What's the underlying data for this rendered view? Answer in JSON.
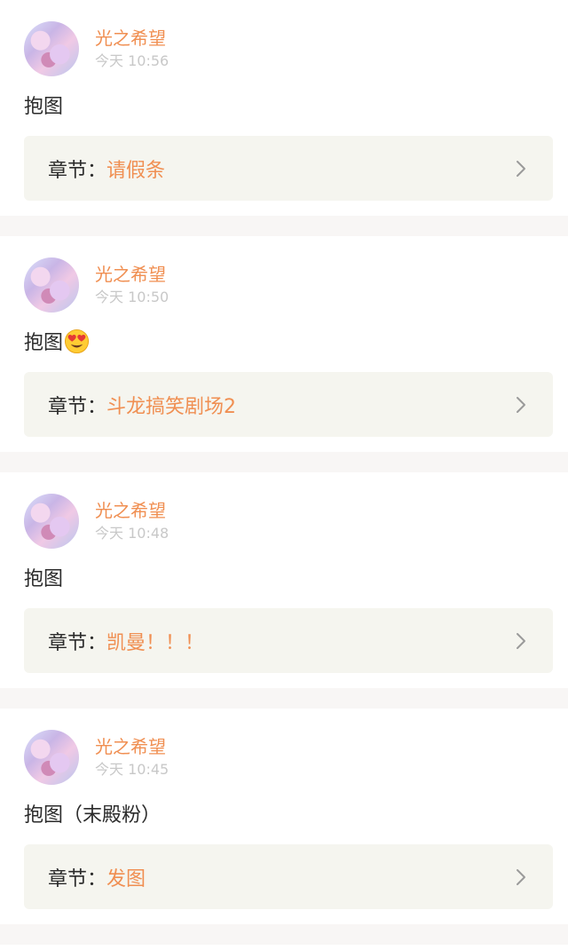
{
  "posts": [
    {
      "author": "光之希望",
      "time": "今天 10:56",
      "content": "抱图",
      "emoji": "",
      "chapter_prefix": "章节：",
      "chapter_title": "请假条"
    },
    {
      "author": "光之希望",
      "time": "今天 10:50",
      "content": "抱图",
      "emoji": "heart-eyes-emoji",
      "chapter_prefix": "章节：",
      "chapter_title": "斗龙搞笑剧场2"
    },
    {
      "author": "光之希望",
      "time": "今天 10:48",
      "content": "抱图",
      "emoji": "",
      "chapter_prefix": "章节：",
      "chapter_title": "凯曼！！！"
    },
    {
      "author": "光之希望",
      "time": "今天 10:45",
      "content": "抱图（末殿粉）",
      "emoji": "",
      "chapter_prefix": "章节：",
      "chapter_title": "发图"
    }
  ],
  "colors": {
    "accent": "#f08f52",
    "separator": "#f8f6f5",
    "chapter_bg": "#f5f5ef",
    "timestamp": "#c8c8c8"
  }
}
